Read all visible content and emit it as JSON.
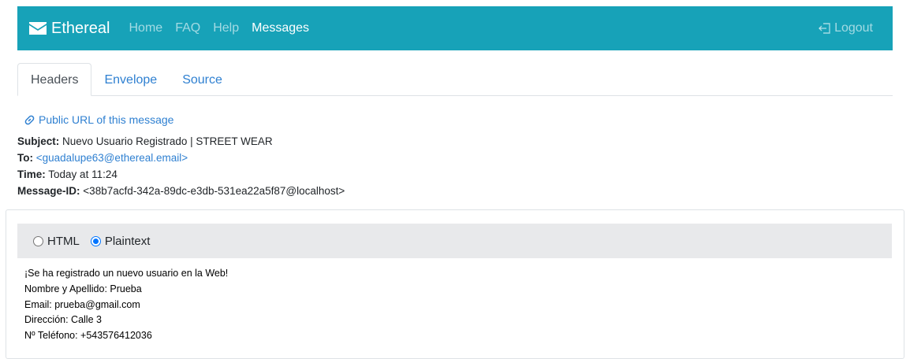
{
  "navbar": {
    "brand": "Ethereal",
    "brand_icon": "envelope-icon",
    "links": [
      {
        "label": "Home",
        "active": false
      },
      {
        "label": "FAQ",
        "active": false
      },
      {
        "label": "Help",
        "active": false
      },
      {
        "label": "Messages",
        "active": true
      }
    ],
    "logout_label": "Logout",
    "logout_icon": "sign-out-icon",
    "background": "#17a2b8"
  },
  "tabs": [
    {
      "label": "Headers",
      "active": true
    },
    {
      "label": "Envelope",
      "active": false
    },
    {
      "label": "Source",
      "active": false
    }
  ],
  "headers": {
    "public_url_label": "Public URL of this message",
    "public_url_icon": "link-icon",
    "subject_label": "Subject:",
    "subject_value": "Nuevo Usuario Registrado | STREET WEAR",
    "to_label": "To:",
    "to_value": "<guadalupe63@ethereal.email>",
    "time_label": "Time:",
    "time_value": "Today at 11:24",
    "message_id_label": "Message-ID:",
    "message_id_value": "<38b7acfd-342a-89dc-e3db-531ea22a5f87@localhost>"
  },
  "body_view": {
    "options": [
      {
        "label": "HTML",
        "checked": false
      },
      {
        "label": "Plaintext",
        "checked": true
      }
    ],
    "lines": [
      "¡Se ha registrado un nuevo usuario en la Web!",
      "Nombre y Apellido: Prueba",
      "Email: prueba@gmail.com",
      "Dirección: Calle 3",
      "Nº Teléfono: +543576412036"
    ]
  },
  "colors": {
    "accent": "#17a2b8",
    "link": "#2f80d1",
    "radio_checked": "#0075ff"
  }
}
